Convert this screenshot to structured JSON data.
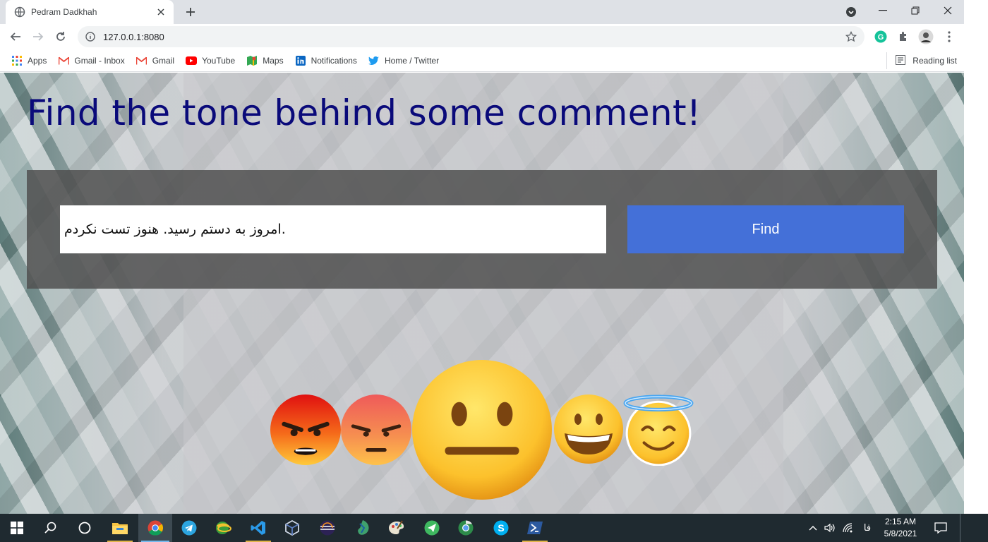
{
  "browser": {
    "tab_title": "Pedram Dadkhah",
    "url": "127.0.0.1:8080",
    "bookmarks": [
      {
        "label": "Apps",
        "icon": "apps-grid-icon"
      },
      {
        "label": "Gmail - Inbox",
        "icon": "gmail-icon"
      },
      {
        "label": "Gmail",
        "icon": "gmail-icon"
      },
      {
        "label": "YouTube",
        "icon": "youtube-icon"
      },
      {
        "label": "Maps",
        "icon": "maps-icon"
      },
      {
        "label": "Notifications",
        "icon": "linkedin-icon"
      },
      {
        "label": "Home / Twitter",
        "icon": "twitter-icon"
      }
    ],
    "reading_list": "Reading list"
  },
  "page": {
    "headline": "Find the tone behind some comment!",
    "comment_value": ".امروز به دستم رسید. هنوز تست نکردم",
    "find_label": "Find",
    "emojis": [
      {
        "name": "very-angry-emoji",
        "tone": "very negative",
        "selected": false
      },
      {
        "name": "angry-emoji",
        "tone": "negative",
        "selected": false
      },
      {
        "name": "neutral-emoji",
        "tone": "neutral",
        "selected": true
      },
      {
        "name": "grinning-emoji",
        "tone": "positive",
        "selected": false
      },
      {
        "name": "angel-emoji",
        "tone": "very positive",
        "selected": false
      }
    ]
  },
  "taskbar": {
    "apps": [
      "start-icon",
      "search-icon",
      "cortana-icon",
      "file-explorer-icon",
      "chrome-icon",
      "telegram-icon",
      "globe-app-icon",
      "vscode-icon",
      "virtualbox-icon",
      "eclipse-icon",
      "network-app-icon",
      "paint-icon",
      "send-app-icon",
      "chrome-canary-icon",
      "skype-icon",
      "powershell-icon"
    ],
    "input_language": "فا",
    "time": "2:15 AM",
    "date": "5/8/2021"
  },
  "colors": {
    "headline": "#0a0a7a",
    "panel": "#505050",
    "find_button": "#4470d8",
    "taskbar": "#1f2a30"
  }
}
